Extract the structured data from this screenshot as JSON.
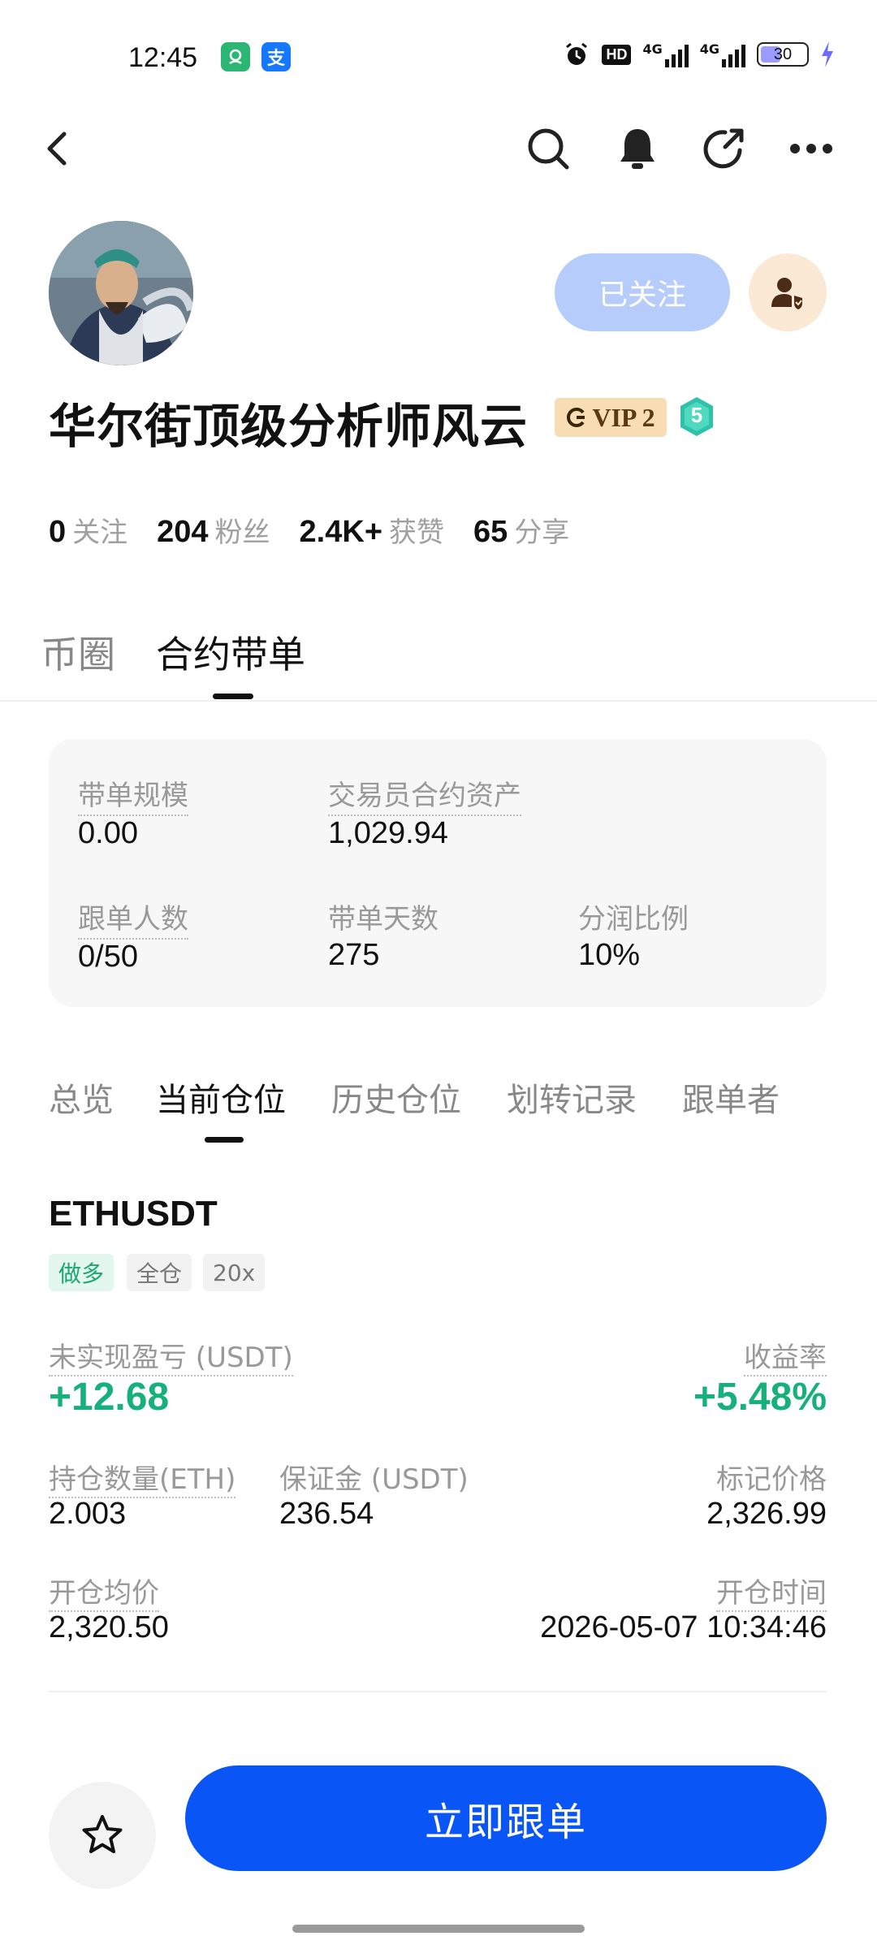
{
  "status_bar": {
    "time": "12:45",
    "app_badges": [
      "运营宝",
      "支"
    ],
    "battery": "30",
    "network": [
      "4G",
      "4G"
    ],
    "hd_label": "HD"
  },
  "nav": {
    "icons": [
      "back-icon",
      "search-icon",
      "bell-icon",
      "share-icon",
      "more-icon"
    ]
  },
  "profile": {
    "follow_label": "已关注",
    "username": "华尔街顶级分析师风云",
    "vip_label": "VIP 2",
    "level": "5",
    "stats": [
      {
        "num": "0",
        "label": "关注"
      },
      {
        "num": "204",
        "label": "粉丝"
      },
      {
        "num": "2.4K+",
        "label": "获赞"
      },
      {
        "num": "65",
        "label": "分享"
      }
    ]
  },
  "main_tabs": [
    {
      "label": "币圈",
      "active": false
    },
    {
      "label": "合约带单",
      "active": true
    }
  ],
  "card": {
    "scale_label": "带单规模",
    "scale_value": "0.00",
    "assets_label": "交易员合约资产",
    "assets_value": "1,029.94",
    "followers_label": "跟单人数",
    "followers_value": "0/50",
    "days_label": "带单天数",
    "days_value": "275",
    "share_label": "分润比例",
    "share_value": "10%"
  },
  "sub_tabs": [
    {
      "label": "总览",
      "active": false
    },
    {
      "label": "当前仓位",
      "active": true
    },
    {
      "label": "历史仓位",
      "active": false
    },
    {
      "label": "划转记录",
      "active": false
    },
    {
      "label": "跟单者",
      "active": false
    }
  ],
  "position": {
    "symbol": "ETHUSDT",
    "tags": [
      "做多",
      "全仓",
      "20x"
    ],
    "unrealized_label": "未实现盈亏 (USDT)",
    "unrealized_value": "+12.68",
    "roi_label": "收益率",
    "roi_value": "+5.48%",
    "qty_label": "持仓数量(ETH)",
    "qty_value": "2.003",
    "margin_label": "保证金 (USDT)",
    "margin_value": "236.54",
    "mark_label": "标记价格",
    "mark_value": "2,326.99",
    "avg_label": "开仓均价",
    "avg_value": "2,320.50",
    "time_label": "开仓时间",
    "time_value": "2026-05-07 10:34:46"
  },
  "bottom": {
    "cta_label": "立即跟单"
  },
  "colors": {
    "primary": "#0a55f5",
    "profit": "#16b07a",
    "follow_btn": "#b6ccfb"
  }
}
